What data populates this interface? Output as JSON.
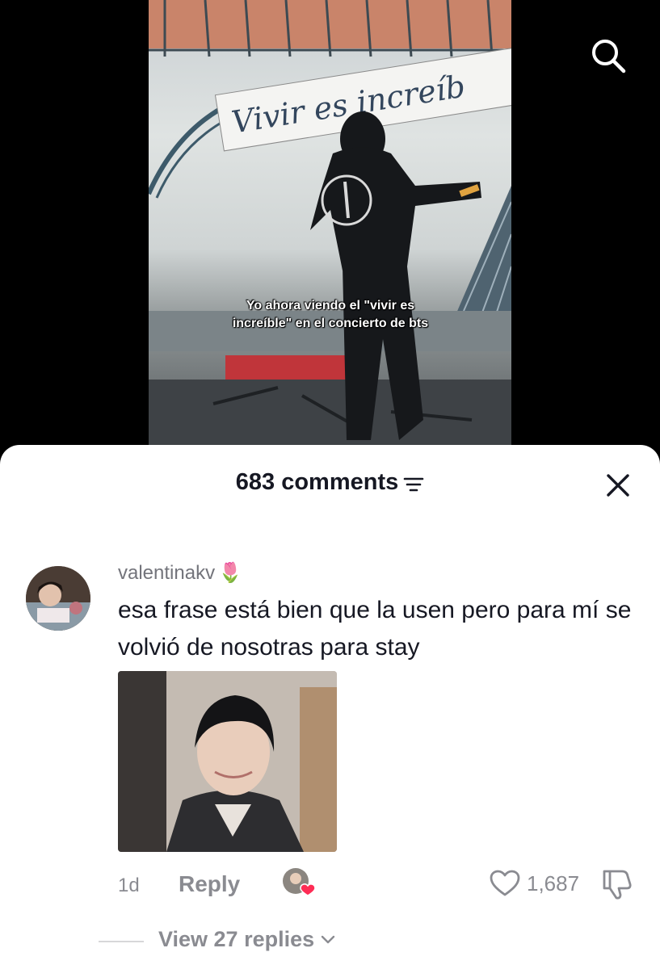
{
  "video": {
    "caption": "Yo ahora viendo el \"vivir es increíble\" en el concierto de bts",
    "banner_text": "Vivir es increíb",
    "search_icon": "search-icon"
  },
  "comments_sheet": {
    "title": "683 comments",
    "filter_icon": "filter-icon",
    "close_icon": "close-icon",
    "comment": {
      "username": "valentinakv",
      "username_emoji": "🌷",
      "text": "esa frase está bien que la usen pero para mí se volvió de nosotras para stay",
      "timestamp": "1d",
      "reply_label": "Reply",
      "like_count": "1,687",
      "view_replies_label": "View 27 replies"
    }
  },
  "colors": {
    "text_primary": "#161823",
    "text_secondary": "#8a8b91",
    "heart_red": "#fe2c55"
  }
}
